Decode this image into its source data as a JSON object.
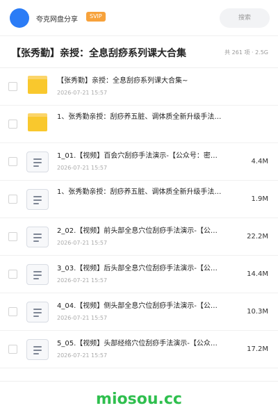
{
  "header": {
    "app_name": "夸克网盘分享",
    "badge": "SVIP",
    "search_placeholder": "搜索"
  },
  "page": {
    "title": "【张秀勤】亲授：全息刮痧系列课大合集",
    "meta": "共 261 项 · 2.5G"
  },
  "items": [
    {
      "type": "folder",
      "name": "【张秀勤】亲授：全息刮痧系列课大合集~",
      "date": "2026-07-21 15:57",
      "size": ""
    },
    {
      "type": "folder",
      "name": "1、张秀勤亲授：刮痧养五脏、调体质全新升级手法…",
      "date": "",
      "size": ""
    },
    {
      "type": "file",
      "name": "1_01.【视频】百会穴刮痧手法演示-【公众号：密…",
      "date": "2026-07-21 15:57",
      "size": "4.4M"
    },
    {
      "type": "file",
      "name": "1、张秀勤亲授：刮痧养五脏、调体质全新升级手法…",
      "date": "",
      "size": "1.9M"
    },
    {
      "type": "file",
      "name": "2_02.【视频】前头部全息穴位刮痧手法演示-【公…",
      "date": "2026-07-21 15:57",
      "size": "22.2M"
    },
    {
      "type": "file",
      "name": "3_03.【视频】后头部全息穴位刮痧手法演示-【公…",
      "date": "2026-07-21 15:57",
      "size": "14.4M"
    },
    {
      "type": "file",
      "name": "4_04.【视频】侧头部全息穴位刮痧手法演示-【公…",
      "date": "2026-07-21 15:57",
      "size": "10.3M"
    },
    {
      "type": "file",
      "name": "5_05.【视频】头部经络穴位刮痧手法演示-【公众…",
      "date": "2026-07-21 15:57",
      "size": "17.2M"
    }
  ],
  "watermark": "miosou.cc",
  "colors": {
    "avatar": "#2b7cf6",
    "badge": "#f7a23b",
    "folder": "#f9c82d",
    "watermark": "#2fbf4e"
  }
}
